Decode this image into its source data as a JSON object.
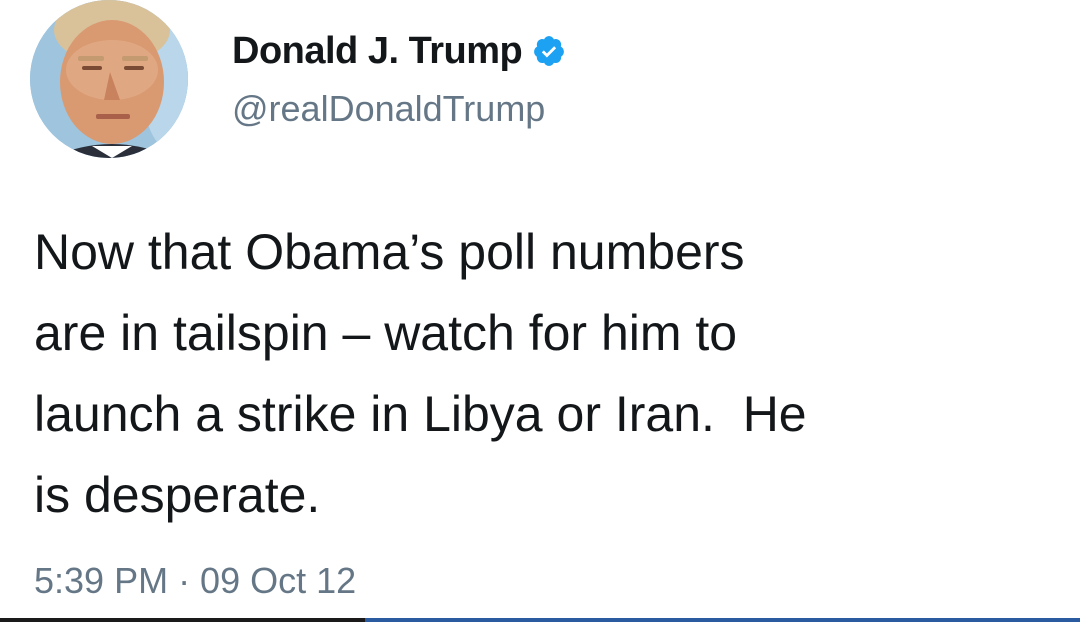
{
  "author": {
    "display_name": "Donald J. Trump",
    "handle": "@realDonaldTrump",
    "verified": true,
    "verified_badge_color": "#1da1f2",
    "avatar_icon": "profile-photo"
  },
  "tweet": {
    "text": "Now that Obama’s poll numbers\nare in tailspin – watch for him to\nlaunch a strike in Libya or Iran.  He\nis desperate.",
    "time": "5:39 PM · 09 Oct 12"
  },
  "colors": {
    "text": "#14171a",
    "secondary_text": "#657786"
  }
}
